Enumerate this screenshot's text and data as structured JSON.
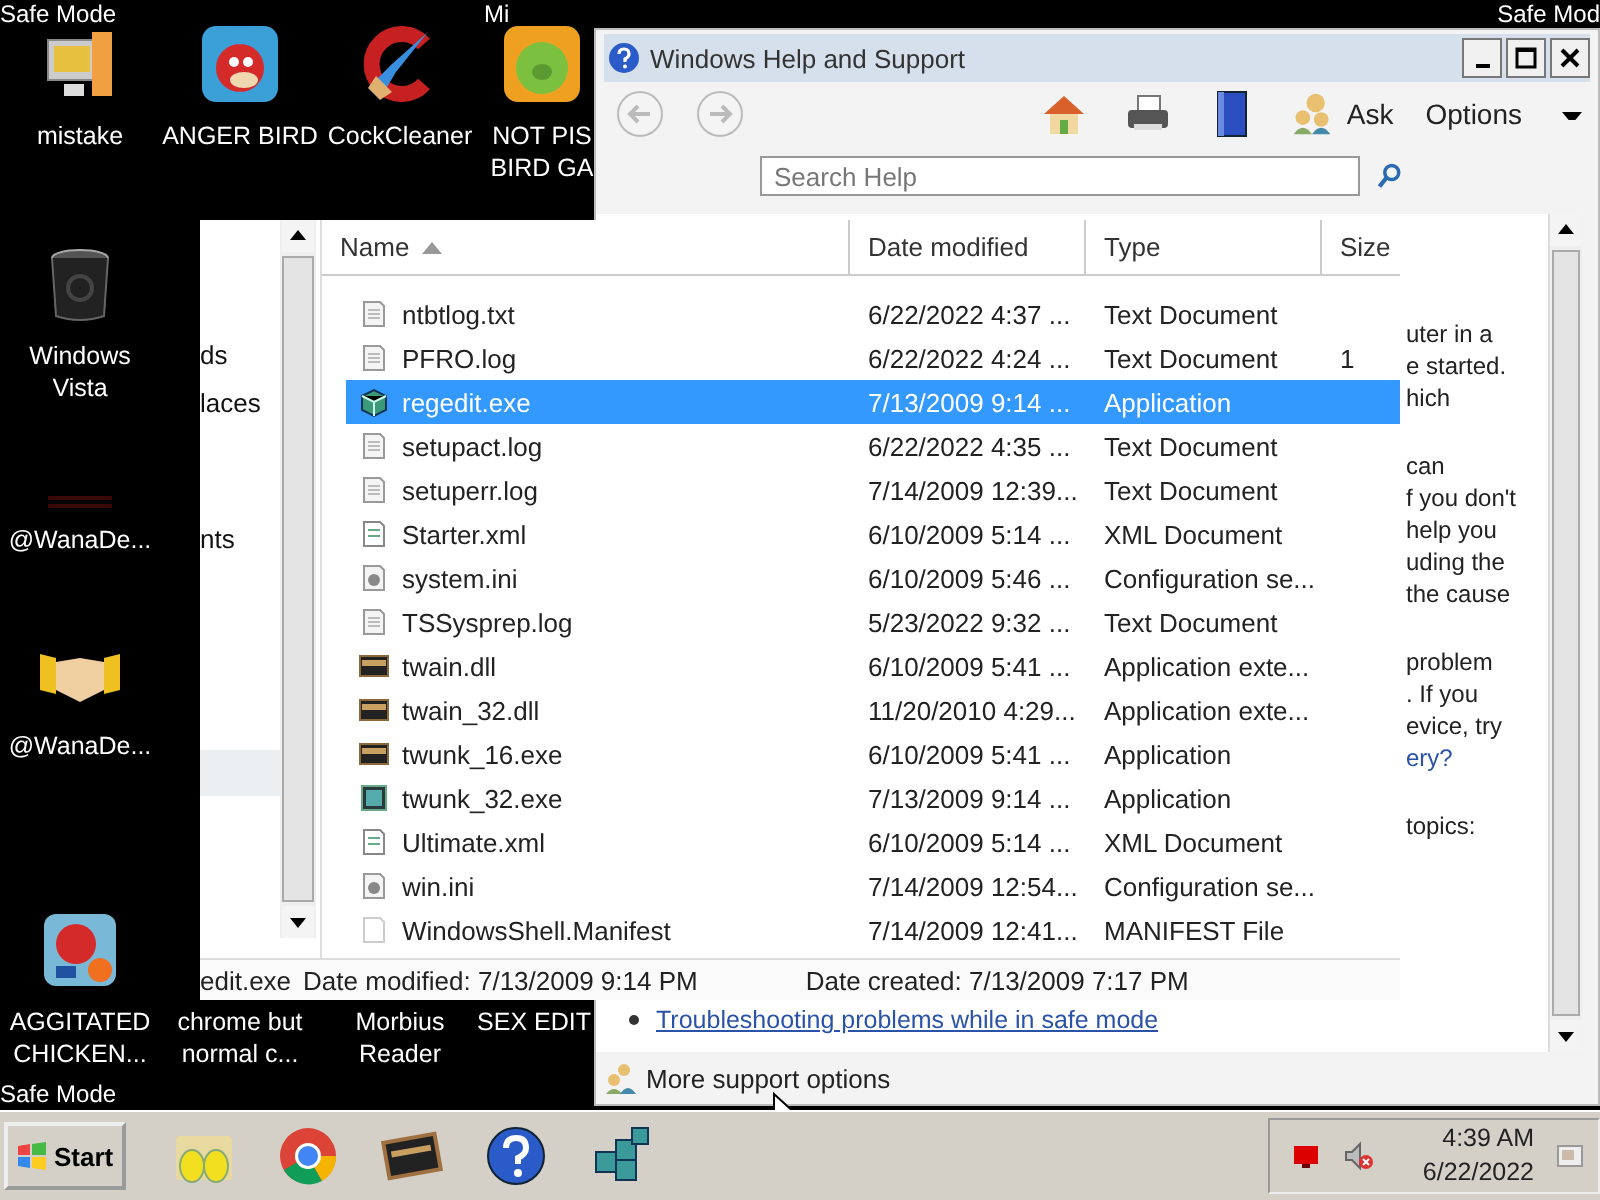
{
  "desktop": {
    "top_labels": [
      "Safe Mode",
      "Mi",
      "Safe Mod"
    ],
    "bottom_label": "Safe Mode",
    "icons": [
      {
        "label": "mistake",
        "kind": "computer"
      },
      {
        "label": "ANGER BIRD",
        "kind": "bird"
      },
      {
        "label": "CockCleaner",
        "kind": "cleaner"
      },
      {
        "label": "NOT PIS\nBIRD GA",
        "kind": "pig"
      },
      {
        "label": "Windows Vista",
        "kind": "trash"
      },
      {
        "label": "@WanaDe...",
        "kind": "faint"
      },
      {
        "label": "@WanaDe...",
        "kind": "handshake"
      },
      {
        "label": "AGGITATED CHICKEN...",
        "kind": "bird-tile"
      },
      {
        "label": "chrome but normal c...",
        "kind": "none"
      },
      {
        "label": "Morbius Reader",
        "kind": "none"
      },
      {
        "label": "SEX EDIT",
        "kind": "none"
      }
    ]
  },
  "explorer": {
    "nav_items": [
      "ds",
      "laces",
      "nts"
    ],
    "columns": [
      "Name",
      "Date modified",
      "Type",
      "Size"
    ],
    "rows": [
      {
        "name": "ntbtlog.txt",
        "date": "6/22/2022 4:37 ...",
        "type": "Text Document",
        "kind": "doc",
        "selected": false
      },
      {
        "name": "PFRO.log",
        "date": "6/22/2022 4:24 ...",
        "type": "Text Document",
        "size": "1",
        "kind": "doc",
        "selected": false
      },
      {
        "name": "regedit.exe",
        "date": "7/13/2009 9:14 ...",
        "type": "Application",
        "kind": "cube",
        "selected": true
      },
      {
        "name": "setupact.log",
        "date": "6/22/2022 4:35 ...",
        "type": "Text Document",
        "kind": "doc",
        "selected": false
      },
      {
        "name": "setuperr.log",
        "date": "7/14/2009 12:39...",
        "type": "Text Document",
        "kind": "doc",
        "selected": false
      },
      {
        "name": "Starter.xml",
        "date": "6/10/2009 5:14 ...",
        "type": "XML Document",
        "kind": "xml",
        "selected": false
      },
      {
        "name": "system.ini",
        "date": "6/10/2009 5:46 ...",
        "type": "Configuration se...",
        "kind": "settings",
        "selected": false
      },
      {
        "name": "TSSysprep.log",
        "date": "5/23/2022 9:32 ...",
        "type": "Text Document",
        "kind": "doc",
        "selected": false
      },
      {
        "name": "twain.dll",
        "date": "6/10/2009 5:41 ...",
        "type": "Application exte...",
        "kind": "window",
        "selected": false
      },
      {
        "name": "twain_32.dll",
        "date": "11/20/2010 4:29...",
        "type": "Application exte...",
        "kind": "window",
        "selected": false
      },
      {
        "name": "twunk_16.exe",
        "date": "6/10/2009 5:41 ...",
        "type": "Application",
        "kind": "window",
        "selected": false
      },
      {
        "name": "twunk_32.exe",
        "date": "7/13/2009 9:14 ...",
        "type": "Application",
        "kind": "scanner",
        "selected": false
      },
      {
        "name": "Ultimate.xml",
        "date": "6/10/2009 5:14 ...",
        "type": "XML Document",
        "kind": "xml",
        "selected": false
      },
      {
        "name": "win.ini",
        "date": "7/14/2009 12:54...",
        "type": "Configuration se...",
        "kind": "settings",
        "selected": false
      },
      {
        "name": "WindowsShell.Manifest",
        "date": "7/14/2009 12:41...",
        "type": "MANIFEST File",
        "kind": "blank",
        "selected": false
      }
    ],
    "details": {
      "name": "edit.exe",
      "modified": "Date modified: 7/13/2009 9:14 PM",
      "created": "Date created: 7/13/2009 7:17 PM"
    }
  },
  "help_window": {
    "title": "Windows Help and Support",
    "ask": "Ask",
    "options": "Options",
    "search": {
      "placeholder": "Search Help"
    },
    "paragraphs": [
      [
        {
          "text": "uter in a",
          "link": false
        },
        {
          "text": "e started.",
          "link": false
        },
        {
          "text": "hich",
          "link": false
        }
      ],
      [
        {
          "text": "can",
          "link": false
        },
        {
          "text": "f you don't",
          "link": false
        },
        {
          "text": "help you",
          "link": false
        },
        {
          "text": "uding the",
          "link": false
        },
        {
          "text": "the cause",
          "link": false
        }
      ],
      [
        {
          "text": "problem",
          "link": false
        },
        {
          "text": ". If you",
          "link": false
        },
        {
          "text": "evice, try",
          "link": false
        },
        {
          "text": "ery?",
          "link": true
        }
      ],
      [
        {
          "text": "topics:",
          "link": false
        }
      ]
    ],
    "topic_link": "Troubleshooting problems while in safe mode",
    "more_support": "More support options"
  },
  "taskbar": {
    "start": "Start",
    "apps": [
      {
        "kind": "eggs"
      },
      {
        "kind": "chrome"
      },
      {
        "kind": "film"
      },
      {
        "kind": "help"
      },
      {
        "kind": "registry"
      }
    ],
    "clock": {
      "time": "4:39 AM",
      "date": "6/22/2022"
    }
  }
}
